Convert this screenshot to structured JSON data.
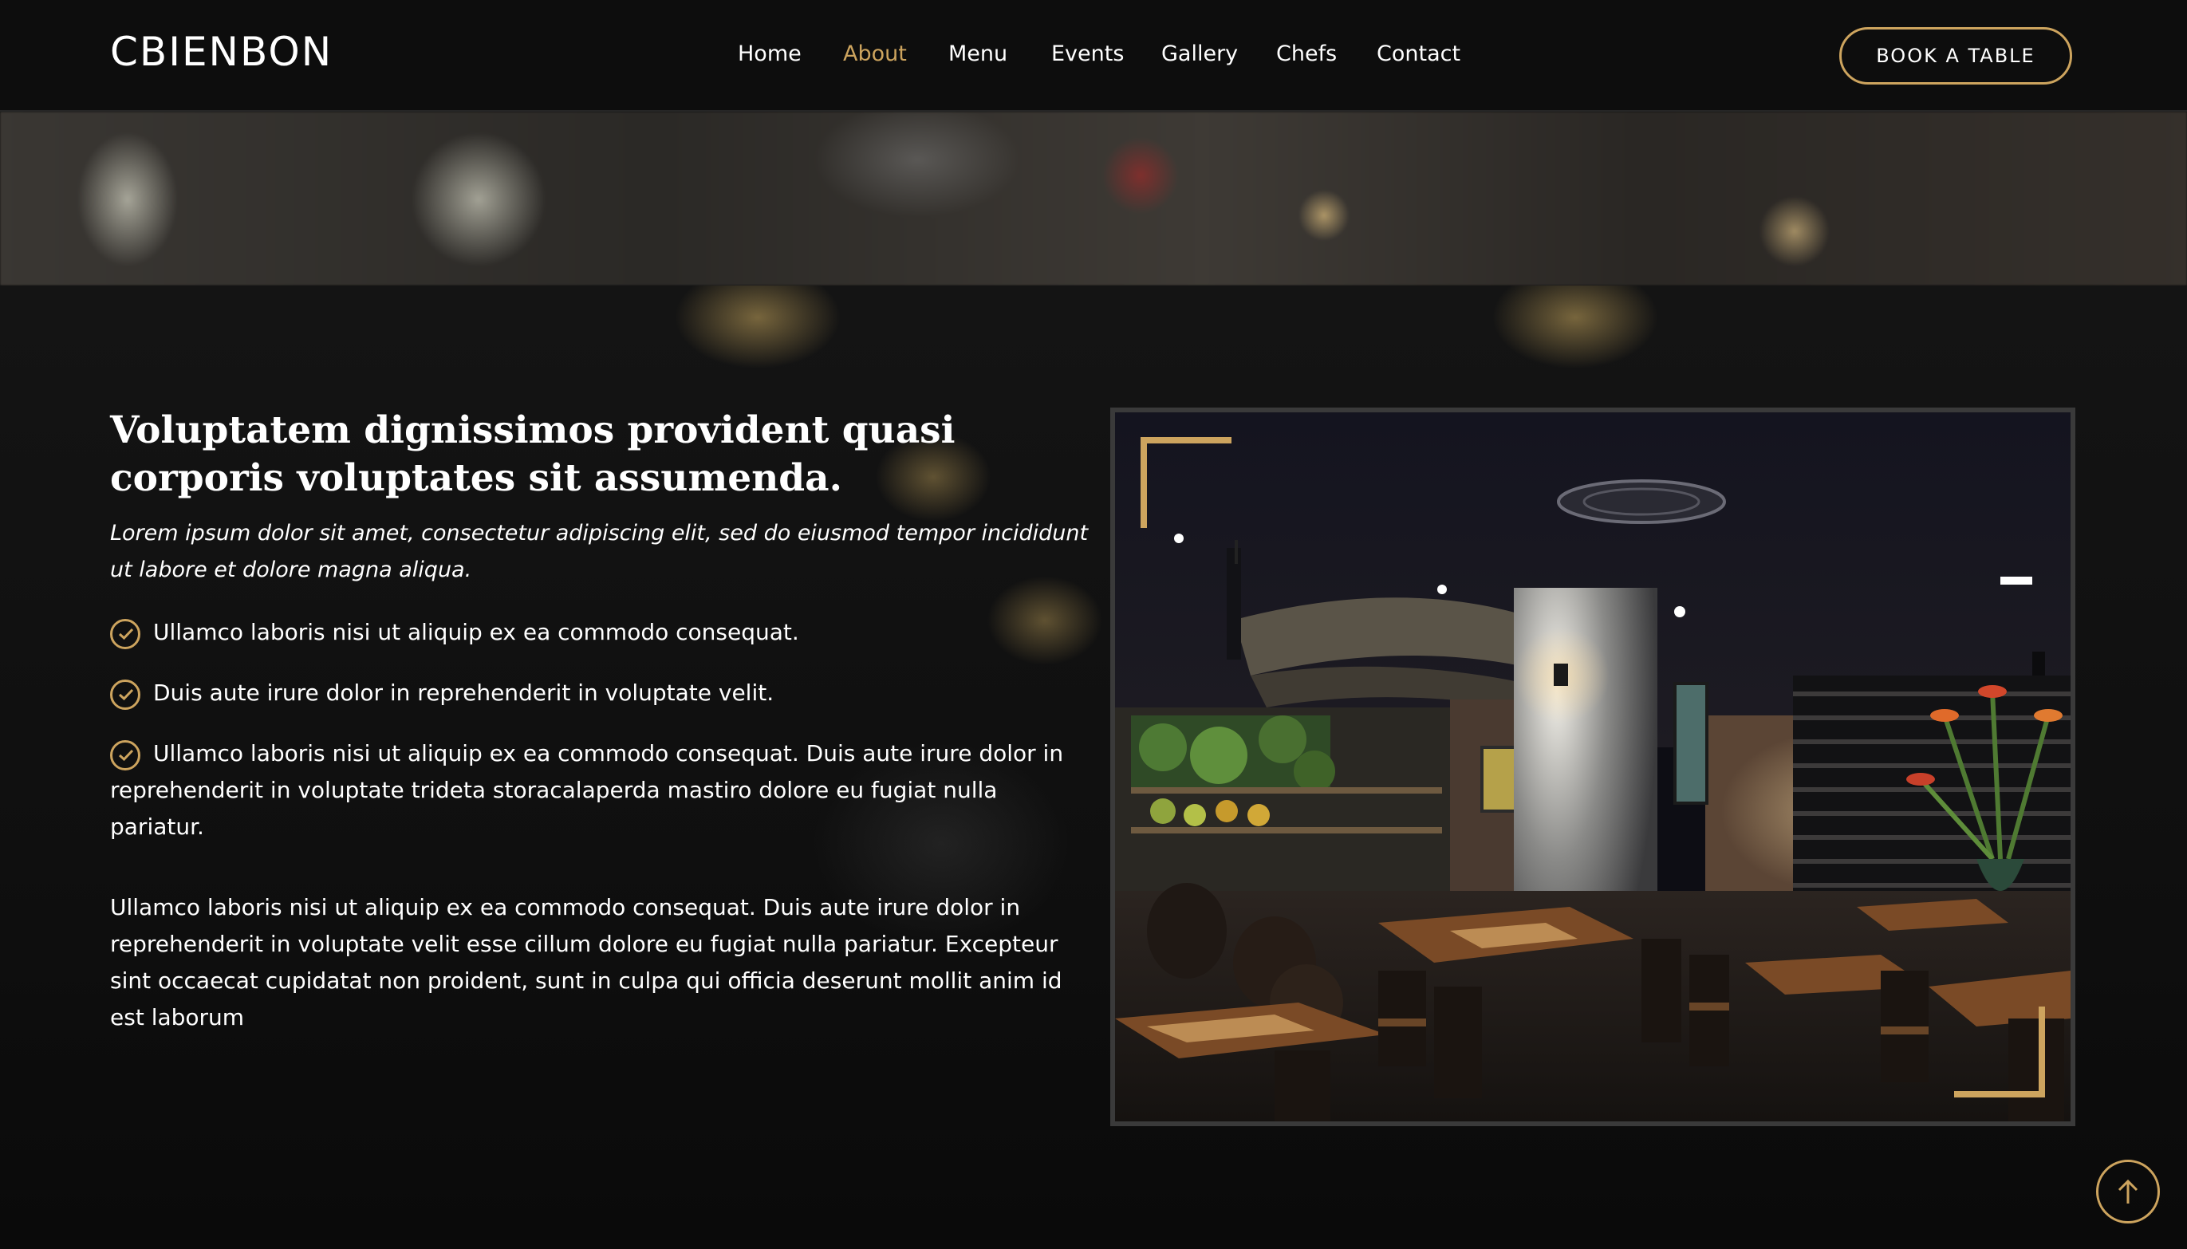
{
  "header": {
    "logo": "CBIENBON",
    "nav": [
      {
        "label": "Home",
        "active": false
      },
      {
        "label": "About",
        "active": true
      },
      {
        "label": "Menu",
        "active": false
      },
      {
        "label": "Events",
        "active": false
      },
      {
        "label": "Gallery",
        "active": false
      },
      {
        "label": "Chefs",
        "active": false
      },
      {
        "label": "Contact",
        "active": false
      }
    ],
    "cta_label": "BOOK A TABLE"
  },
  "about": {
    "title": "Voluptatem dignissimos provident quasi corporis voluptates sit assumenda.",
    "lead": "Lorem ipsum dolor sit amet, consectetur adipiscing elit, sed do eiusmod tempor incididunt ut labore et dolore magna aliqua.",
    "list": [
      "Ullamco laboris nisi ut aliquip ex ea commodo consequat.",
      "Duis aute irure dolor in reprehenderit in voluptate velit.",
      "Ullamco laboris nisi ut aliquip ex ea commodo consequat. Duis aute irure dolor in reprehenderit in voluptate trideta storacalaperda mastiro dolore eu fugiat nulla pariatur."
    ],
    "paragraph": "Ullamco laboris nisi ut aliquip ex ea commodo consequat. Duis aute irure dolor in reprehenderit in voluptate velit esse cillum dolore eu fugiat nulla pariatur. Excepteur sint occaecat cupidatat non proident, sunt in culpa qui officia deserunt mollit anim id est laborum"
  },
  "icons": {
    "list_bullet": "check-circle-icon",
    "back_to_top": "arrow-up-icon"
  },
  "colors": {
    "accent": "#cda45e",
    "background": "#0c0b09",
    "text": "#ffffff"
  }
}
